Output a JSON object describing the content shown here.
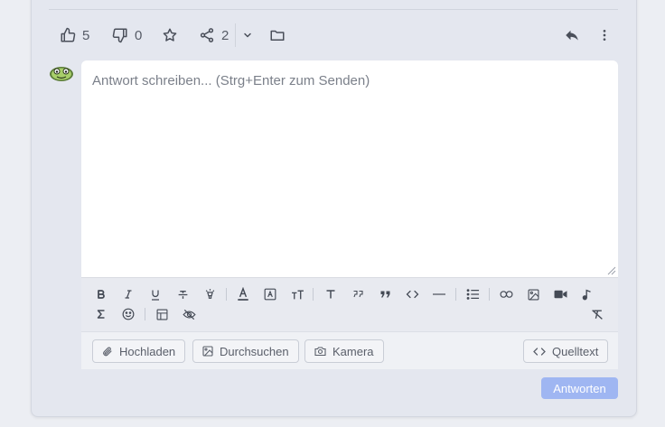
{
  "reactions": {
    "like_count": "5",
    "dislike_count": "0",
    "share_count": "2"
  },
  "editor": {
    "placeholder": "Antwort schreiben... (Strg+Enter zum Senden)"
  },
  "toolbar": {
    "row1": [
      "bold-icon",
      "italic-icon",
      "underline-icon",
      "strikethrough-icon",
      "highlight-icon",
      "text-color-icon",
      "text-background-icon",
      "font-size-icon",
      "heading-icon",
      "quote-icon",
      "blockquote-icon",
      "code-icon",
      "horizontal-rule-icon",
      "bullet-list-icon",
      "link-icon",
      "image-icon",
      "video-icon",
      "audio-icon"
    ],
    "row2": [
      "formula-icon",
      "emoji-icon",
      "table-icon",
      "spoiler-icon",
      "clear-format-icon"
    ]
  },
  "upload": {
    "upload_label": "Hochladen",
    "browse_label": "Durchsuchen",
    "camera_label": "Kamera",
    "source_label": "Quelltext"
  },
  "submit_label": "Antworten",
  "colors": {
    "accent": "#9fb6f2",
    "card_bg": "#e4e7ef",
    "editor_bg": "#ffffff"
  }
}
